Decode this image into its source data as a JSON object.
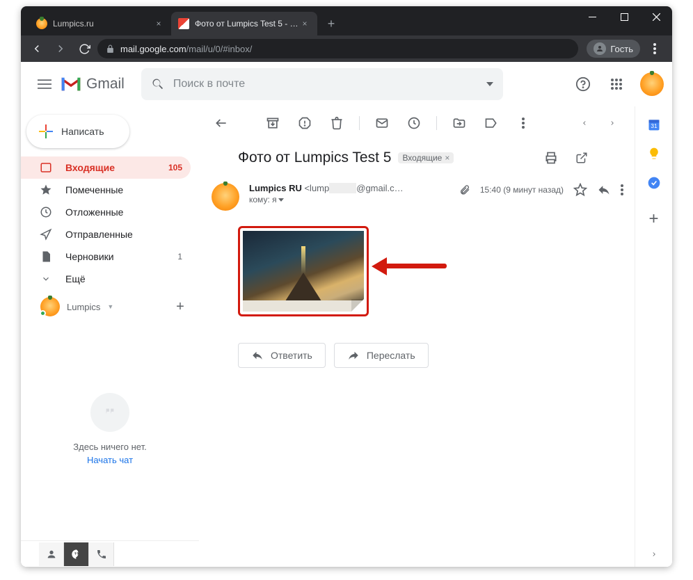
{
  "browser": {
    "tabs": [
      {
        "title": "Lumpics.ru",
        "favColor": "#ff9800"
      },
      {
        "title": "Фото от Lumpics Test 5 - lumpfir",
        "favGmail": true
      }
    ],
    "url_host": "mail.google.com",
    "url_path": "/mail/u/0/#inbox/",
    "guest": "Гость"
  },
  "gmail": {
    "logo": "Gmail",
    "search_placeholder": "Поиск в почте",
    "compose": "Написать",
    "nav": {
      "inbox": "Входящие",
      "inbox_count": "105",
      "starred": "Помеченные",
      "snoozed": "Отложенные",
      "sent": "Отправленные",
      "drafts": "Черновики",
      "drafts_count": "1",
      "more": "Ещё"
    },
    "hangouts": {
      "name": "Lumpics",
      "empty": "Здесь ничего нет.",
      "start": "Начать чат"
    },
    "message": {
      "subject": "Фото от Lumpics Test 5",
      "chip": "Входящие",
      "sender_name": "Lumpics RU",
      "sender_email_prefix": "<lump",
      "sender_email_suffix": "@gmail.c…",
      "to_label": "кому: я",
      "time": "15:40 (9 минут назад)",
      "reply": "Ответить",
      "forward": "Переслать"
    }
  }
}
